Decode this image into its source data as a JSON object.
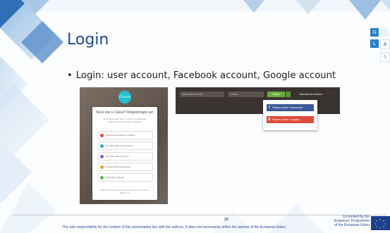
{
  "slide": {
    "title": "Login",
    "bullet": "Login: user account, Facebook account, Google account",
    "page_number": "12",
    "disclaimer": "The sole responsibility for the content of this presentation lies with the authors. It does not necessarily reflect the opinion of the European Union.",
    "cofunded": [
      "Co-funded by the",
      "Erasmus+ Programme",
      "of the European Union"
    ],
    "corner_tiles": [
      "G",
      "L",
      "A",
      "\\"
    ]
  },
  "canva_shot": {
    "logo_text": "Canva",
    "card_title": "Novi ste u Canvi? Registrirajte se!",
    "card_subtitle": "Da biste koristili Canvu, morate se registrirati. Odaberite opciju koja vam odgovara.",
    "options": [
      {
        "label": "Za osobnu upotrebu ili za školu",
        "color": "#e2453c"
      },
      {
        "label": "Za male tvrtke ili rad od kuće",
        "color": "#2aa6d8"
      },
      {
        "label": "Za velike tvrtke ili timove",
        "color": "#8e56c9"
      },
      {
        "label": "Za neprofitne organizacije",
        "color": "#f0a21e"
      },
      {
        "label": "Za učitelje i učenike",
        "color": "#58b947"
      }
    ],
    "footer": "Prijavom prihvaćate Uvjete korištenja. Već imate račun? Prijavite se."
  },
  "fb_shot": {
    "email_placeholder": "Vaša adresa e-pošte",
    "password_placeholder": "Lozinka",
    "login_button": "Prijava",
    "forgot_link": "Zaboravili ste lozinku?",
    "facebook_option": "Prijava putem Facebooka",
    "google_option": "Prijava putem Googlea"
  }
}
